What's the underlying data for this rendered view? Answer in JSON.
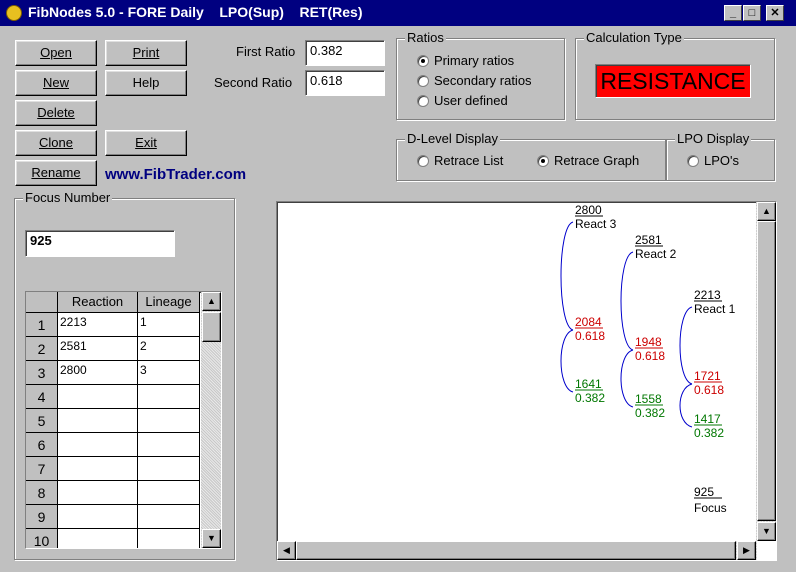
{
  "window": {
    "title": "FibNodes 5.0 - FORE Daily    LPO(Sup)    RET(Res)",
    "minimize": "_",
    "maximize": "□",
    "close": "✕"
  },
  "buttons": {
    "open": "Open",
    "print": "Print",
    "new": "New",
    "help": "Help",
    "delete": "Delete",
    "clone": "Clone",
    "exit": "Exit",
    "rename": "Rename"
  },
  "ratios_input": {
    "first_label": "First Ratio",
    "first_value": "0.382",
    "second_label": "Second Ratio",
    "second_value": "0.618"
  },
  "ratios_group": {
    "legend": "Ratios",
    "options": [
      "Primary ratios",
      "Secondary ratios",
      "User defined"
    ],
    "selected": 0
  },
  "calc_type": {
    "legend": "Calculation Type",
    "value": "RESISTANCE",
    "color": "#ff0000"
  },
  "dlevel": {
    "legend": "D-Level Display",
    "options": [
      "Retrace List",
      "Retrace Graph"
    ],
    "selected": 1
  },
  "lpo": {
    "legend": "LPO Display",
    "option": "LPO's"
  },
  "website": "www.FibTrader.com",
  "focus": {
    "legend": "Focus Number",
    "value": "925"
  },
  "grid": {
    "headers": [
      "Reaction",
      "Lineage"
    ],
    "rows": [
      {
        "n": "1",
        "reaction": "2213",
        "lineage": "1"
      },
      {
        "n": "2",
        "reaction": "2581",
        "lineage": "2"
      },
      {
        "n": "3",
        "reaction": "2800",
        "lineage": "3"
      },
      {
        "n": "4",
        "reaction": "",
        "lineage": ""
      },
      {
        "n": "5",
        "reaction": "",
        "lineage": ""
      },
      {
        "n": "6",
        "reaction": "",
        "lineage": ""
      },
      {
        "n": "7",
        "reaction": "",
        "lineage": ""
      },
      {
        "n": "8",
        "reaction": "",
        "lineage": ""
      },
      {
        "n": "9",
        "reaction": "",
        "lineage": ""
      },
      {
        "n": "10",
        "reaction": "",
        "lineage": ""
      }
    ]
  },
  "graph": {
    "colors": {
      "bracket": "#0000cc",
      "ratio_618": "#cc0000",
      "ratio_382": "#007700",
      "text": "#000000"
    },
    "nodes": [
      {
        "value": "2800",
        "label": "React 3",
        "r618": "2084",
        "r618_label": "0.618",
        "r382": "1641",
        "r382_label": "0.382"
      },
      {
        "value": "2581",
        "label": "React 2",
        "r618": "1948",
        "r618_label": "0.618",
        "r382": "1558",
        "r382_label": "0.382"
      },
      {
        "value": "2213",
        "label": "React 1",
        "r618": "1721",
        "r618_label": "0.618",
        "r382": "1417",
        "r382_label": "0.382"
      }
    ],
    "focus": {
      "value": "925",
      "label": "Focus"
    }
  }
}
